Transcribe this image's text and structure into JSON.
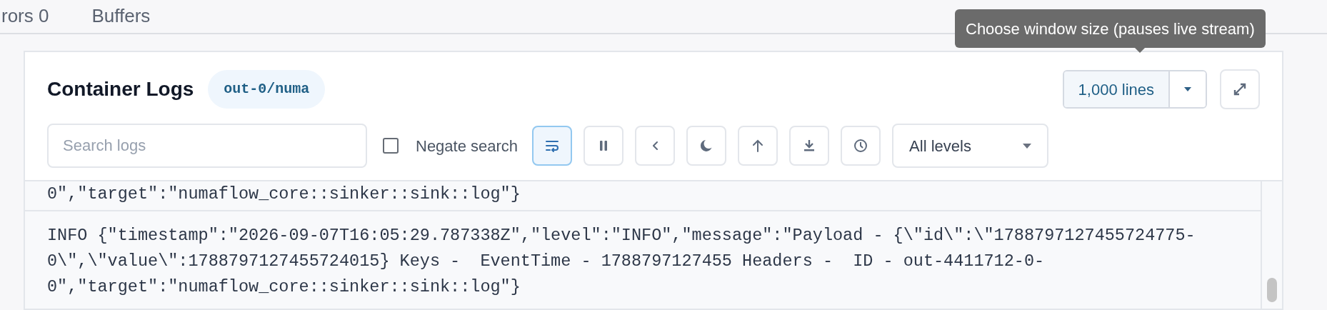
{
  "tabs": [
    {
      "label": "rors 0",
      "selected": false
    },
    {
      "label": "Buffers",
      "selected": false
    }
  ],
  "tooltip": "Choose window size (pauses live stream)",
  "panel": {
    "title": "Container Logs",
    "badge": "out-0/numa",
    "window_size": {
      "value": "1,000 lines"
    },
    "search": {
      "placeholder": "Search logs"
    },
    "negate_search": {
      "label": "Negate search",
      "checked": false
    },
    "toolbar": [
      {
        "kind": "wrap",
        "on": true
      },
      {
        "kind": "pause",
        "on": false
      },
      {
        "kind": "back",
        "on": false
      },
      {
        "kind": "theme",
        "on": false
      },
      {
        "kind": "top",
        "on": false
      },
      {
        "kind": "download",
        "on": false
      },
      {
        "kind": "time",
        "on": false
      }
    ],
    "level_filter": {
      "value": "All levels"
    },
    "logs": [
      {
        "lines": [
          "0\",\"target\":\"numaflow_core::sinker::sink::log\"}"
        ]
      },
      {
        "lines": [
          "INFO {\"timestamp\":\"2026-09-07T16:05:29.787338Z\",\"level\":\"INFO\",\"message\":\"Payload - {\\\"id\\\":\\\"1788797127455724775-",
          "0\\\",\\\"value\\\":1788797127455724015} Keys -  EventTime - 1788797127455 Headers -  ID - out-4411712-0-",
          "0\",\"target\":\"numaflow_core::sinker::sink::log\"}"
        ]
      }
    ]
  }
}
